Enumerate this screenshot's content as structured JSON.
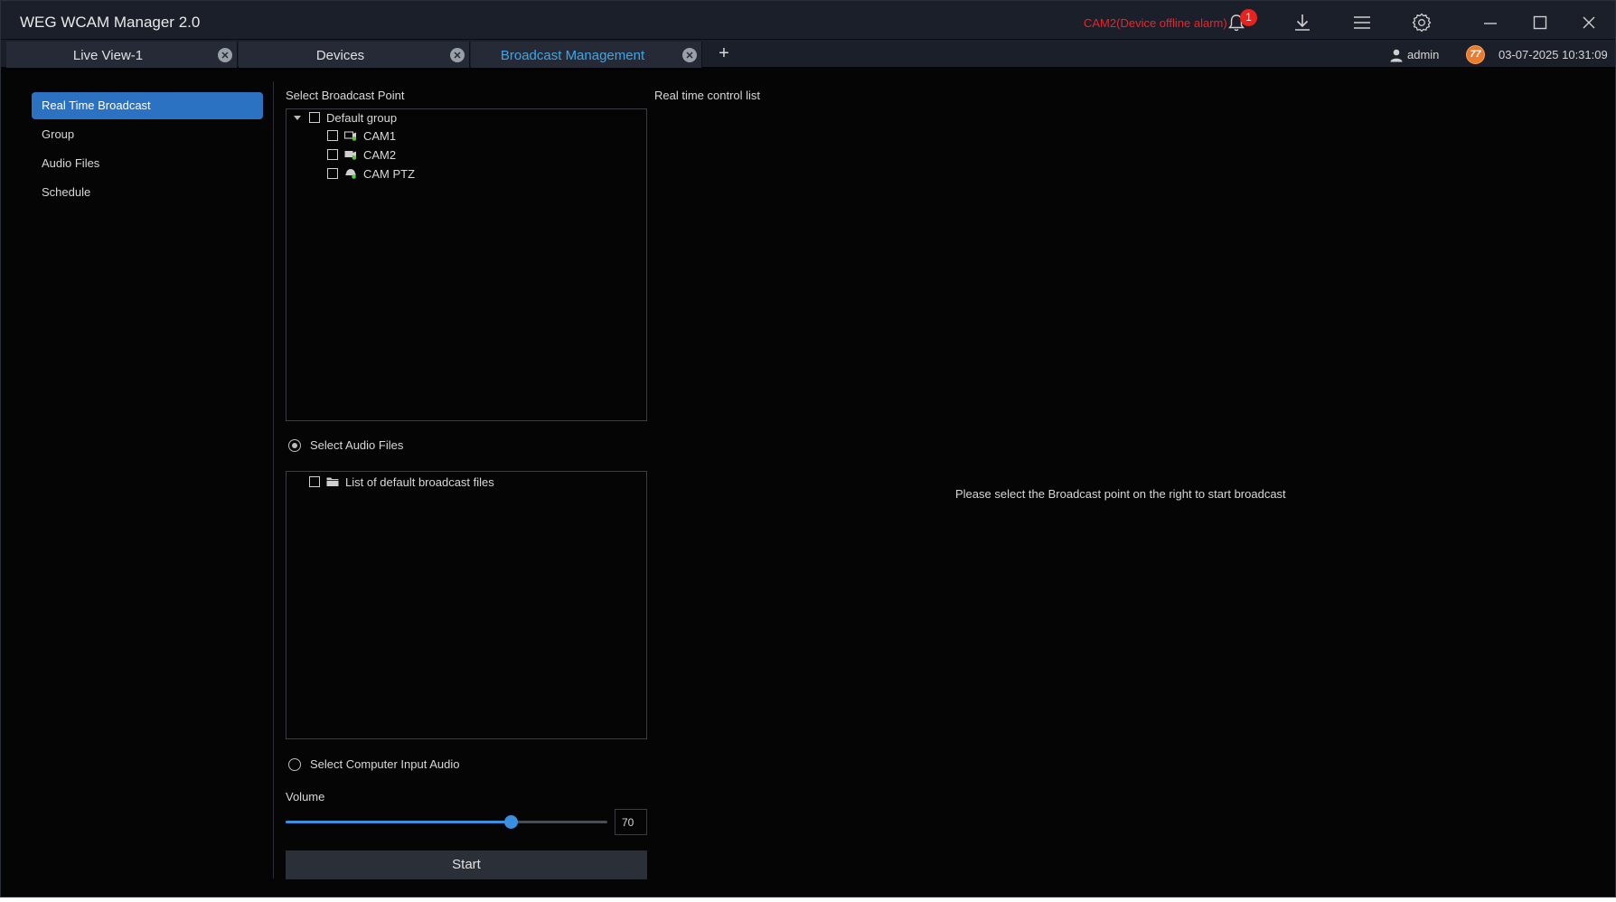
{
  "app": {
    "title": "WEG WCAM Manager 2.0"
  },
  "alarm": {
    "text": "CAM2(Device offline alarm)",
    "count": "1"
  },
  "title_icons": [
    "bell-icon",
    "download-icon",
    "menu-icon",
    "settings-icon",
    "minimize-icon",
    "maximize-icon",
    "close-icon"
  ],
  "tabs": [
    {
      "label": "Live View-1",
      "active": false
    },
    {
      "label": "Devices",
      "active": false
    },
    {
      "label": "Broadcast Management",
      "active": true
    }
  ],
  "status": {
    "user": "admin",
    "cpu": "77",
    "datetime": "03-07-2025 10:31:09"
  },
  "sidebar": {
    "items": [
      {
        "label": "Real Time Broadcast",
        "active": true
      },
      {
        "label": "Group",
        "active": false
      },
      {
        "label": "Audio Files",
        "active": false
      },
      {
        "label": "Schedule",
        "active": false
      }
    ]
  },
  "broadcast_point": {
    "label": "Select Broadcast Point",
    "group": "Default group",
    "devices": [
      {
        "name": "CAM1",
        "icon": "camera-online-icon"
      },
      {
        "name": "CAM2",
        "icon": "camera-offline-icon"
      },
      {
        "name": "CAM PTZ",
        "icon": "ptz-camera-icon"
      }
    ]
  },
  "audio_source": {
    "files_label": "Select Audio Files",
    "files_selected": true,
    "file_list_item": "List of default broadcast files",
    "computer_label": "Select Computer Input Audio"
  },
  "volume": {
    "label": "Volume",
    "value": "70",
    "level": 70
  },
  "start_label": "Start",
  "control_list": {
    "label": "Real time control list",
    "hint": "Please select the Broadcast point on the right to start broadcast"
  },
  "colors": {
    "accent": "#2c72c3",
    "alarm": "#e8252b",
    "active_tab": "#3ea6e6",
    "background": "#050505",
    "titlebar": "#1b1f29"
  }
}
